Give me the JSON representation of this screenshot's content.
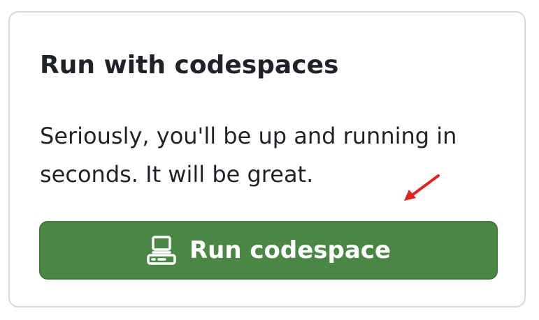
{
  "card": {
    "title": "Run with codespaces",
    "description": "Seriously, you'll be up and running in seconds. It will be great.",
    "button_label": "Run codespace",
    "button_icon": "codespaces-icon",
    "annotation_icon": "red-arrow-icon"
  },
  "colors": {
    "button_background": "#4a8744",
    "button_border": "#3f7a3a",
    "button_text": "#ffffff",
    "card_border": "#d7d9dc",
    "text": "#1f2328",
    "annotation_arrow": "#e5201f"
  }
}
